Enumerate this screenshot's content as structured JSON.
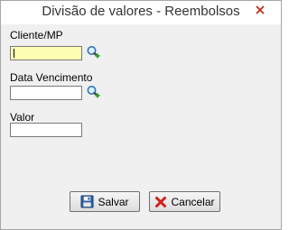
{
  "window": {
    "title": "Divisão de valores - Reembolsos",
    "close_glyph": "✕",
    "close_color": "#c42b1c"
  },
  "form": {
    "cliente": {
      "label": "Cliente/MP",
      "value": "",
      "lookup_icon": "search-add-icon"
    },
    "vencimento": {
      "label": "Data Vencimento",
      "value": "",
      "lookup_icon": "search-add-icon"
    },
    "valor": {
      "label": "Valor",
      "value": ""
    }
  },
  "buttons": {
    "save": {
      "label": "Salvar",
      "icon": "floppy-disk-icon"
    },
    "cancel": {
      "label": "Cancelar",
      "icon": "red-x-icon"
    }
  },
  "colors": {
    "active_field_bg": "#fdfdb4",
    "window_bg": "#f0f0f0"
  }
}
